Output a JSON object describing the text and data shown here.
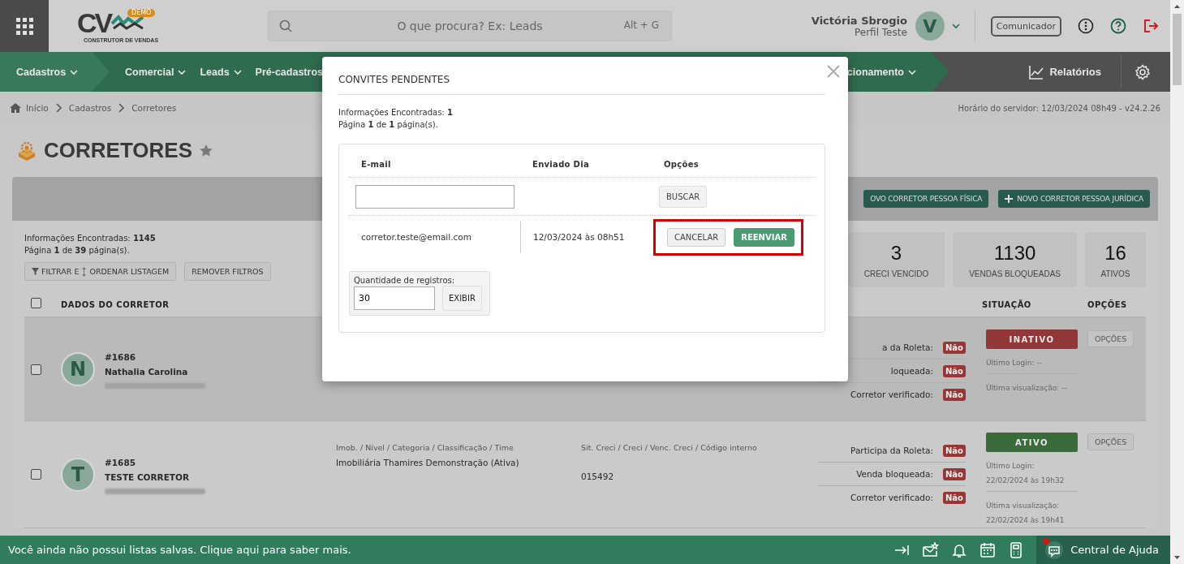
{
  "topbar": {
    "logo": {
      "letters": "CV",
      "badge": "DEMO",
      "tagline": "CONSTRUTOR DE VENDAS"
    },
    "search": {
      "placeholder": "O que procura? Ex: Leads",
      "shortcut": "Alt + G"
    },
    "user": {
      "name": "Victória Sbrogio",
      "profile": "Perfil Teste",
      "initial": "V"
    },
    "communicator": "Comunicador"
  },
  "nav": {
    "items": [
      {
        "label": "Cadastros",
        "selected": true
      },
      {
        "label": "Comercial",
        "selected": false
      },
      {
        "label": "Leads",
        "selected": false
      },
      {
        "label": "Pré-cadastros",
        "selected": false
      }
    ],
    "partial_item": "cionamento",
    "reports": "Relatórios"
  },
  "breadcrumb": {
    "items": [
      "Início",
      "Cadastros",
      "Corretores"
    ],
    "server_time": "Horário do servidor: 12/03/2024 08h49 - v24.2.26"
  },
  "page": {
    "title": "CORRETORES",
    "favorite": false
  },
  "toolbar": [
    {
      "label": "OVO CORRETOR PESSOA FÍSICA",
      "plus": false
    },
    {
      "label": "NOVO CORRETOR PESSOA JURÍDICA",
      "plus": true
    }
  ],
  "summary": {
    "found": "Informações Encontradas: **1145**",
    "pages": "Página **1** de **39** página(s).",
    "filter_button": [
      "FILTRAR E",
      "ORDENAR LISTAGEM"
    ],
    "clear_button": "REMOVER FILTROS"
  },
  "stats": [
    {
      "value": "3",
      "label": "CRECI VENCIDO"
    },
    {
      "value": "1130",
      "label": "VENDAS BLOQUEADAS"
    },
    {
      "value": "16",
      "label": "ATIVOS"
    }
  ],
  "table": {
    "select_all": false,
    "columns": [
      "DADOS DO CORRETOR",
      "SITUAÇÃO",
      "OPÇÕES"
    ],
    "rows": [
      {
        "checked": false,
        "highlighted": true,
        "initial": "N",
        "id": "#1686",
        "name": "Nathalia Carolina",
        "props": [
          {
            "label": "a da Roleta:",
            "value": "Não"
          },
          {
            "label": "loqueada:",
            "value": "Não"
          },
          {
            "label": "Corretor verificado:",
            "value": "Não"
          }
        ],
        "status": {
          "label": "INATIVO",
          "active": false
        },
        "login": [
          "Último Login: --"
        ],
        "view": [
          "Última visualização: --"
        ],
        "options": "OPÇÕES"
      },
      {
        "checked": false,
        "highlighted": false,
        "initial": "T",
        "id": "#1685",
        "name": "TESTE CORRETOR",
        "details": [
          {
            "label": "Imob. / Nível / Categoria / Classificação / Time",
            "value": "Imobiliária Thamires Demonstração (Ativa)"
          },
          {
            "label": "Sit. Creci / Creci / Venc. Creci / Código interno",
            "value": "015492"
          }
        ],
        "props": [
          {
            "label": "Participa da Roleta:",
            "value": "Não"
          },
          {
            "label": "Venda bloqueada:",
            "value": "Não"
          },
          {
            "label": "Corretor verificado:",
            "value": "Não"
          }
        ],
        "status": {
          "label": "ATIVO",
          "active": true
        },
        "login": [
          "Último Login:",
          "22/02/2024 às 19h32"
        ],
        "view": [
          "Última visualização:",
          "22/02/2024 às 19h41"
        ],
        "options": "OPÇÕES"
      }
    ]
  },
  "modal": {
    "title": "CONVITES PENDENTES",
    "found": "Informações Encontradas: **1**",
    "pages": "Página **1** de **1** página(s).",
    "columns": [
      "E-mail",
      "Enviado Dia",
      "Opções"
    ],
    "search_button": "BUSCAR",
    "rows": [
      {
        "email": "corretor.teste@email.com",
        "sent": "12/03/2024 às 08h51",
        "highlighted": true,
        "actions": [
          {
            "label": "CANCELAR",
            "kind": "default"
          },
          {
            "label": "REENVIAR",
            "kind": "primary"
          }
        ]
      }
    ],
    "page_size": {
      "label": "Quantidade de registros:",
      "value": "30",
      "button": "EXIBIR"
    }
  },
  "status_bar": {
    "message": "Você ainda não possui listas salvas. Clique aqui para saber mais.",
    "help": "Central de Ajuda",
    "help_notification": true
  }
}
